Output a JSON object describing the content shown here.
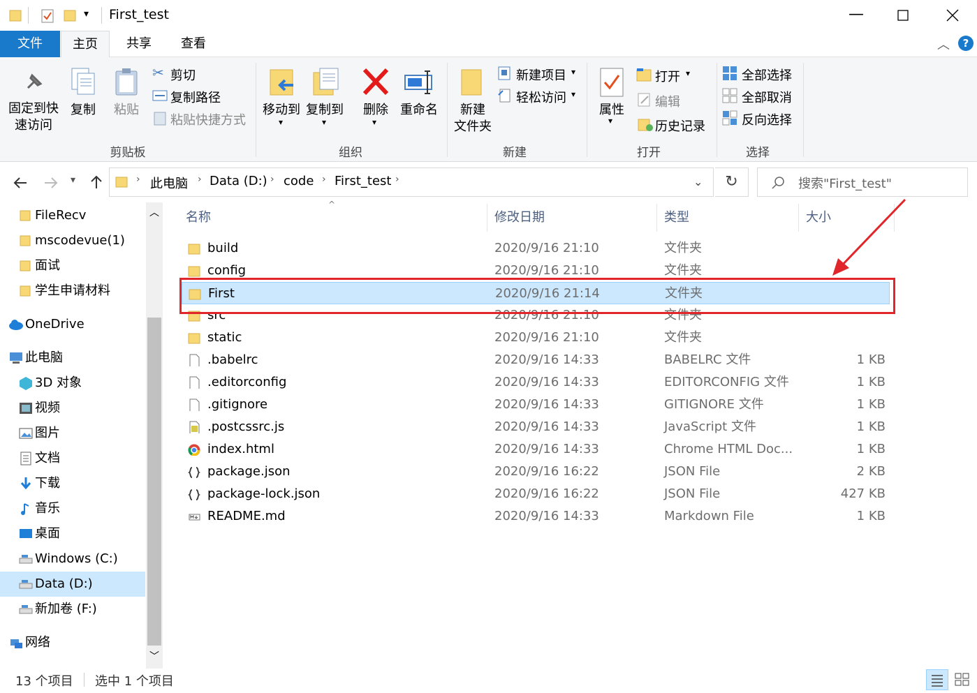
{
  "window": {
    "title": "First_test"
  },
  "tabs": {
    "file": "文件",
    "home": "主页",
    "share": "共享",
    "view": "查看"
  },
  "ribbon": {
    "pin_quick_access": [
      "固定到快",
      "速访问"
    ],
    "copy": "复制",
    "paste": "粘贴",
    "cut": "剪切",
    "copy_path": "复制路径",
    "paste_shortcut": "粘贴快捷方式",
    "group_clipboard": "剪贴板",
    "move_to": "移动到",
    "copy_to": "复制到",
    "delete": "删除",
    "rename": "重命名",
    "group_organize": "组织",
    "new_folder": [
      "新建",
      "文件夹"
    ],
    "new_item": "新建项目",
    "easy_access": "轻松访问",
    "group_new": "新建",
    "properties": "属性",
    "open": "打开",
    "edit": "编辑",
    "history": "历史记录",
    "group_open": "打开",
    "select_all": "全部选择",
    "select_none": "全部取消",
    "invert_selection": "反向选择",
    "group_select": "选择"
  },
  "address": {
    "breadcrumbs": [
      "此电脑",
      "Data (D:)",
      "code",
      "First_test"
    ],
    "search_placeholder": "搜索\"First_test\""
  },
  "sidebar": {
    "items": [
      {
        "label": "FileRecv",
        "icon": "folder-icon"
      },
      {
        "label": "mscodevue(1)",
        "icon": "folder-icon"
      },
      {
        "label": "面试",
        "icon": "folder-icon"
      },
      {
        "label": "学生申请材料",
        "icon": "folder-icon"
      },
      {
        "label": "OneDrive",
        "icon": "cloud-icon"
      },
      {
        "label": "此电脑",
        "icon": "computer-icon"
      },
      {
        "label": "3D 对象",
        "icon": "cube-icon"
      },
      {
        "label": "视频",
        "icon": "video-icon"
      },
      {
        "label": "图片",
        "icon": "picture-icon"
      },
      {
        "label": "文档",
        "icon": "document-icon"
      },
      {
        "label": "下载",
        "icon": "download-icon"
      },
      {
        "label": "音乐",
        "icon": "music-icon"
      },
      {
        "label": "桌面",
        "icon": "desktop-icon"
      },
      {
        "label": "Windows (C:)",
        "icon": "drive-icon"
      },
      {
        "label": "Data (D:)",
        "icon": "drive-icon"
      },
      {
        "label": "新加卷 (F:)",
        "icon": "drive-icon"
      },
      {
        "label": "网络",
        "icon": "network-icon"
      }
    ]
  },
  "columns": {
    "name": "名称",
    "date": "修改日期",
    "type": "类型",
    "size": "大小"
  },
  "files": [
    {
      "name": "build",
      "date": "2020/9/16 21:10",
      "type": "文件夹",
      "size": "",
      "icon": "folder-icon"
    },
    {
      "name": "config",
      "date": "2020/9/16 21:10",
      "type": "文件夹",
      "size": "",
      "icon": "folder-icon"
    },
    {
      "name": "First",
      "date": "2020/9/16 21:14",
      "type": "文件夹",
      "size": "",
      "icon": "folder-icon"
    },
    {
      "name": "src",
      "date": "2020/9/16 21:10",
      "type": "文件夹",
      "size": "",
      "icon": "folder-icon"
    },
    {
      "name": "static",
      "date": "2020/9/16 21:10",
      "type": "文件夹",
      "size": "",
      "icon": "folder-icon"
    },
    {
      "name": ".babelrc",
      "date": "2020/9/16 14:33",
      "type": "BABELRC 文件",
      "size": "1 KB",
      "icon": "file-icon"
    },
    {
      "name": ".editorconfig",
      "date": "2020/9/16 14:33",
      "type": "EDITORCONFIG 文件",
      "size": "1 KB",
      "icon": "file-icon"
    },
    {
      "name": ".gitignore",
      "date": "2020/9/16 14:33",
      "type": "GITIGNORE 文件",
      "size": "1 KB",
      "icon": "file-icon"
    },
    {
      "name": ".postcssrc.js",
      "date": "2020/9/16 14:33",
      "type": "JavaScript 文件",
      "size": "1 KB",
      "icon": "js-file-icon"
    },
    {
      "name": "index.html",
      "date": "2020/9/16 14:33",
      "type": "Chrome HTML Doc...",
      "size": "1 KB",
      "icon": "chrome-icon"
    },
    {
      "name": "package.json",
      "date": "2020/9/16 16:22",
      "type": "JSON File",
      "size": "2 KB",
      "icon": "json-file-icon"
    },
    {
      "name": "package-lock.json",
      "date": "2020/9/16 16:22",
      "type": "JSON File",
      "size": "427 KB",
      "icon": "json-file-icon"
    },
    {
      "name": "README.md",
      "date": "2020/9/16 14:33",
      "type": "Markdown File",
      "size": "1 KB",
      "icon": "markdown-file-icon"
    }
  ],
  "status": {
    "count": "13 个项目",
    "selected": "选中 1 个项目"
  },
  "colors": {
    "accent": "#1979ca",
    "selection": "#cce8ff",
    "annotation": "#e0262a",
    "folder": "#f8d775"
  }
}
